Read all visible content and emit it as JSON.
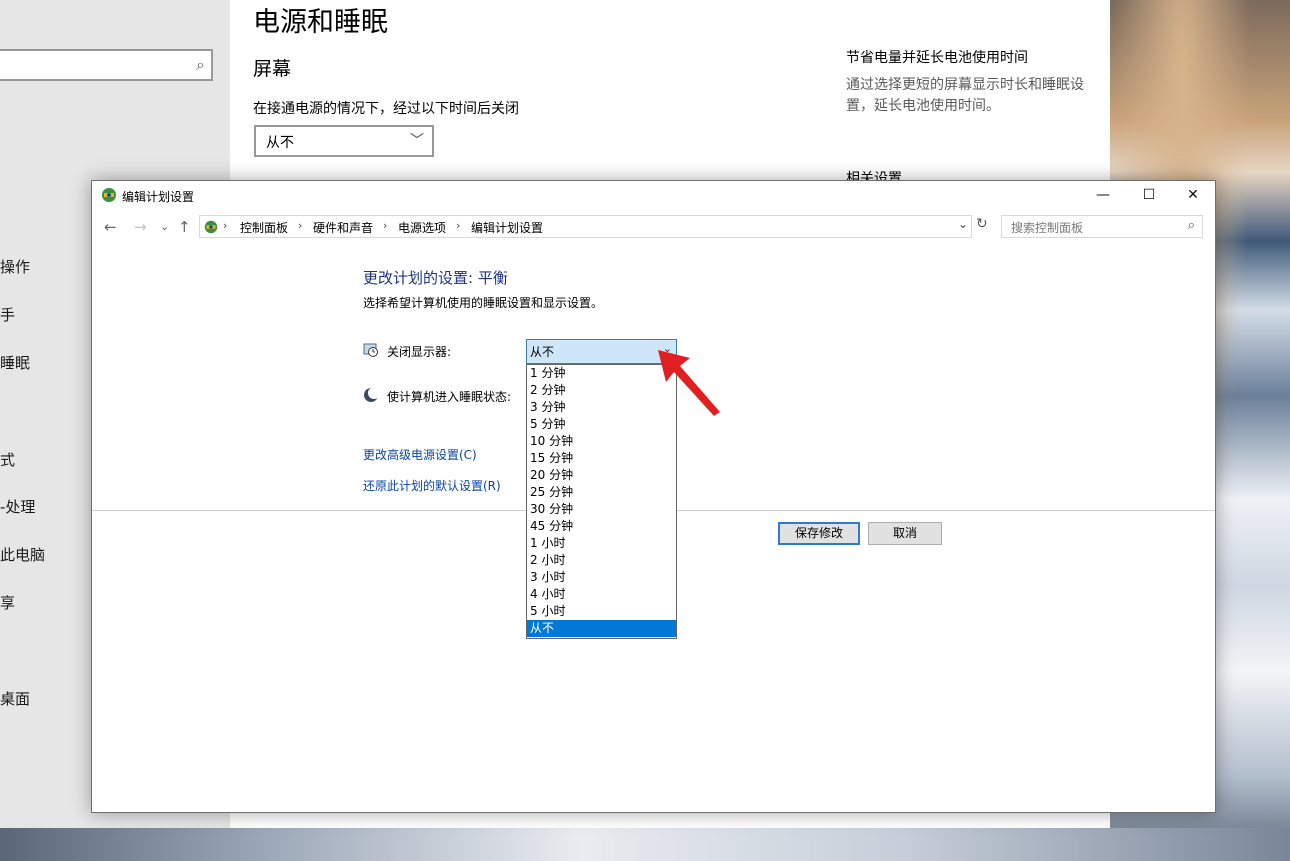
{
  "settings": {
    "title": "电源和睡眠",
    "screen_heading": "屏幕",
    "plugged_in_label": "在接通电源的情况下，经过以下时间后关闭",
    "plugged_in_value": "从不",
    "side_title": "节省电量并延长电池使用时间",
    "side_desc": "通过选择更短的屏幕显示时长和睡眠设置，延长电池使用时间。",
    "related_label": "相关设置",
    "nav_items": [
      "操作",
      "手",
      "睡眠",
      "式",
      "-处理",
      "此电脑",
      "享",
      "",
      "桌面"
    ]
  },
  "dialog": {
    "title": "编辑计划设置",
    "breadcrumbs": [
      "控制面板",
      "硬件和声音",
      "电源选项",
      "编辑计划设置"
    ],
    "search_placeholder": "搜索控制面板",
    "heading": "更改计划的设置: 平衡",
    "subheading": "选择希望计算机使用的睡眠设置和显示设置。",
    "display_off_label": "关闭显示器:",
    "sleep_label": "使计算机进入睡眠状态:",
    "display_off_value": "从不",
    "advanced_link": "更改高级电源设置(C)",
    "restore_link": "还原此计划的默认设置(R)",
    "save_button": "保存修改",
    "cancel_button": "取消",
    "dropdown_options": [
      "1 分钟",
      "2 分钟",
      "3 分钟",
      "5 分钟",
      "10 分钟",
      "15 分钟",
      "20 分钟",
      "25 分钟",
      "30 分钟",
      "45 分钟",
      "1 小时",
      "2 小时",
      "3 小时",
      "4 小时",
      "5 小时",
      "从不"
    ],
    "selected_option": "从不"
  },
  "colors": {
    "link": "#0645ad",
    "heading": "#1e3287",
    "selection": "#0078d7",
    "annotation_arrow": "#e02020"
  }
}
